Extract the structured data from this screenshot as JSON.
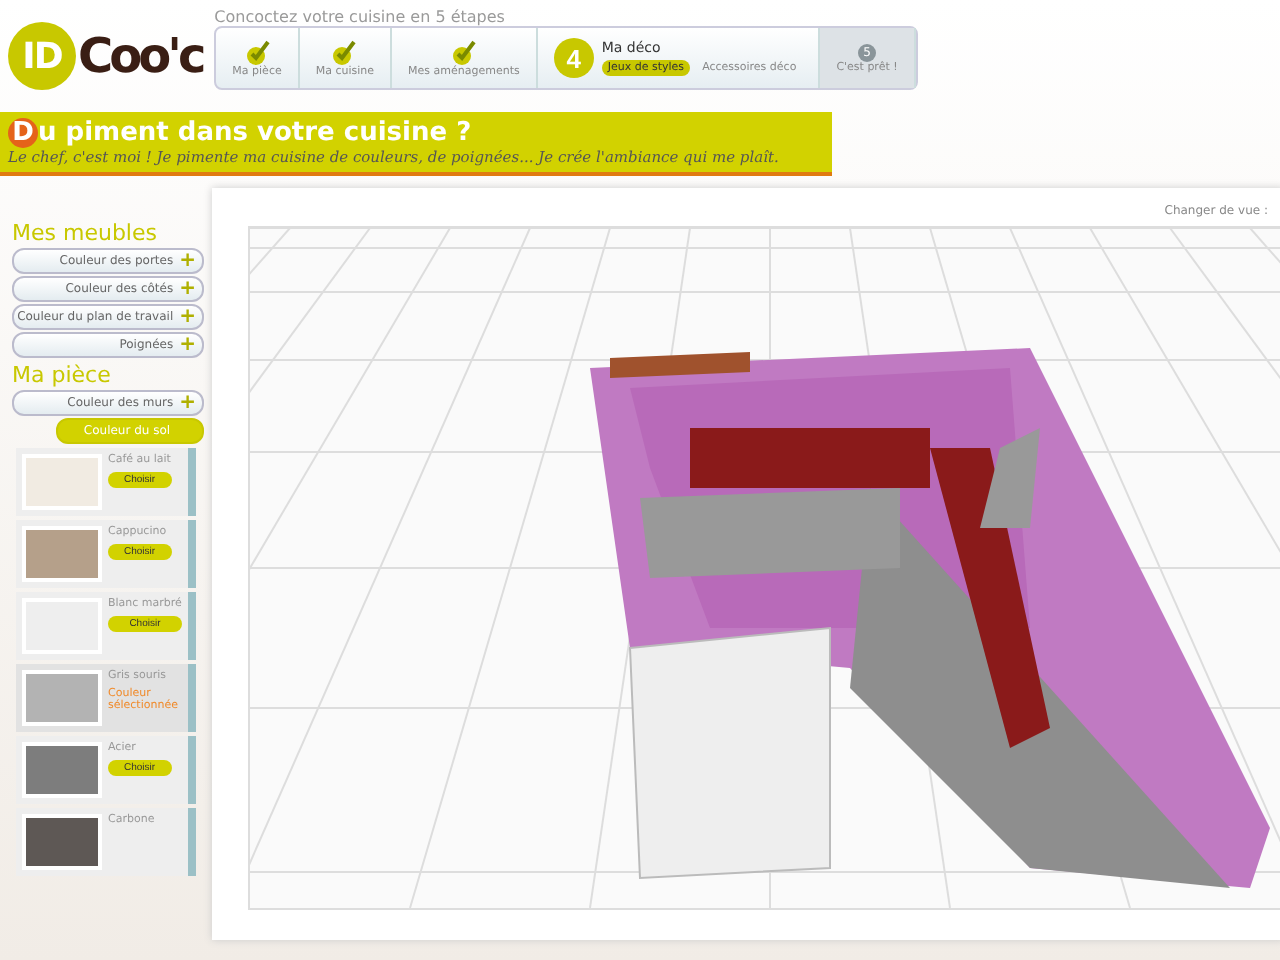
{
  "header": {
    "logo": {
      "part_1": "ID",
      "part_2": "Coo'c"
    },
    "tagline": "Concoctez votre cuisine en 5 étapes",
    "steps": [
      {
        "kind": "done",
        "label": "Ma pièce"
      },
      {
        "kind": "done",
        "label": "Ma cuisine"
      },
      {
        "kind": "done",
        "label": "Mes aménagements"
      },
      {
        "kind": "current",
        "number": "4",
        "label": "Ma déco",
        "subtabs": [
          {
            "label": "Jeux de styles",
            "selected": true
          },
          {
            "label": "Accessoires déco",
            "selected": false
          }
        ]
      },
      {
        "kind": "todo",
        "number": "5",
        "label": "C'est prêt !"
      }
    ]
  },
  "banner": {
    "initial": "D",
    "title": "u piment dans votre cuisine ?",
    "subtitle": "Le chef, c'est moi ! Je pimente ma cuisine de couleurs, de poignées... Je crée l'ambiance qui me plaît."
  },
  "sidebar": {
    "sections": [
      {
        "title": "Mes meubles",
        "items": [
          {
            "label": "Couleur des portes",
            "icon": "+",
            "expanded": false
          },
          {
            "label": "Couleur des côtés",
            "icon": "+",
            "expanded": false
          },
          {
            "label": "Couleur du plan de travail",
            "icon": "+",
            "expanded": false
          },
          {
            "label": "Poignées",
            "icon": "+",
            "expanded": false
          }
        ]
      },
      {
        "title": "Ma pièce",
        "items": [
          {
            "label": "Couleur des murs",
            "icon": "+",
            "expanded": false
          },
          {
            "label": "Couleur du sol",
            "expanded": true
          }
        ]
      }
    ],
    "swatches": [
      {
        "name": "Café au lait",
        "color": "#f1ebe2",
        "selected": false,
        "button": "Choisir"
      },
      {
        "name": "Cappucino",
        "color": "#b5a08a",
        "selected": false,
        "button": "Choisir"
      },
      {
        "name": "Blanc marbré",
        "color": "#eeeeee",
        "selected": false,
        "button": "Choisir"
      },
      {
        "name": "Gris souris",
        "color": "#b3b3b3",
        "selected": true,
        "status": "Couleur sélectionnée"
      },
      {
        "name": "Acier",
        "color": "#7d7d7d",
        "selected": false,
        "button": "Choisir"
      },
      {
        "name": "Carbone",
        "color": "#5e5855",
        "selected": false
      }
    ]
  },
  "view": {
    "change_view": "Changer de vue :"
  }
}
